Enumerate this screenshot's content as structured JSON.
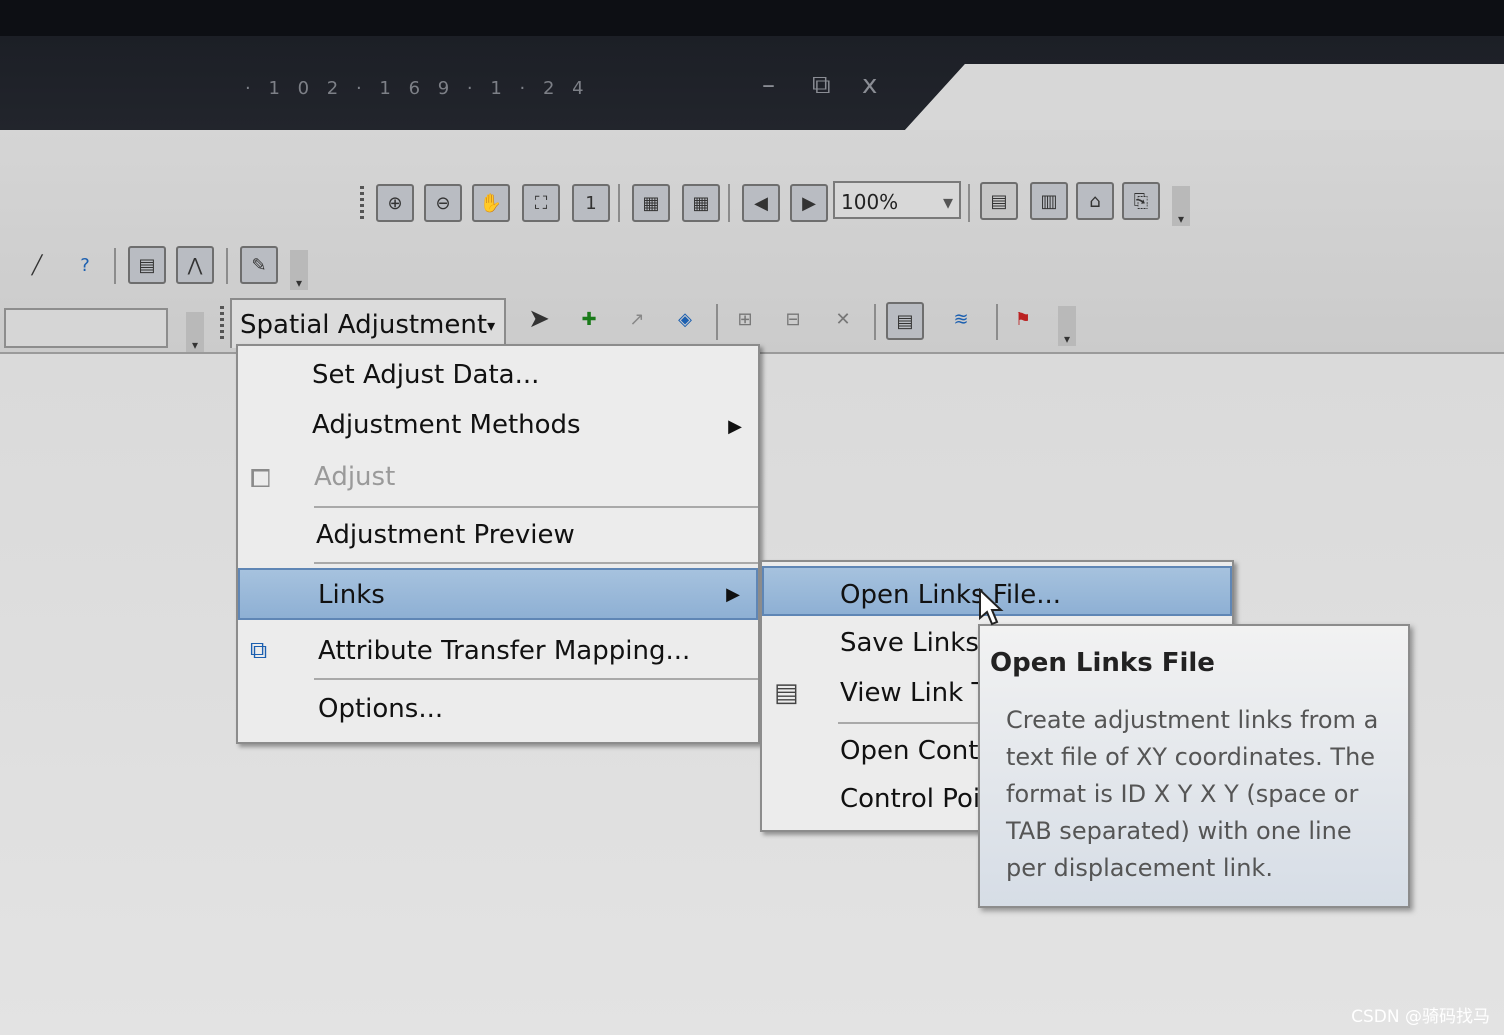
{
  "window": {
    "title": "· 1 0 2 · 1 6 9 · 1 · 2 4",
    "minimize_label": "–",
    "restore_label": "⧉",
    "close_label": "x"
  },
  "toolbar": {
    "zoom_value": "100%",
    "spatial_adjustment_label": "Spatial Adjustment",
    "spatial_adjustment_arrow": "▾"
  },
  "menu": {
    "items": [
      {
        "label": "Set Adjust Data...",
        "enabled": true
      },
      {
        "label": "Adjustment Methods",
        "enabled": true,
        "submenu": true
      },
      {
        "label": "Adjust",
        "enabled": false
      },
      {
        "label": "Adjustment Preview",
        "enabled": true
      },
      {
        "label": "Links",
        "enabled": true,
        "submenu": true,
        "highlighted": true
      },
      {
        "label": "Attribute Transfer Mapping...",
        "enabled": true
      },
      {
        "label": "Options...",
        "enabled": true
      }
    ],
    "submenu_arrow": "▶"
  },
  "links_submenu": {
    "items": [
      {
        "label": "Open Links File...",
        "highlighted": true
      },
      {
        "label": "Save Links"
      },
      {
        "label": "View Link T"
      },
      {
        "label": "Open Cont"
      },
      {
        "label": "Control Poi"
      }
    ]
  },
  "tooltip": {
    "title": "Open Links File",
    "body": "Create adjustment links from a text file of XY coordinates. The format is ID X Y X Y (space or TAB separated) with one line per displacement link."
  },
  "watermark": "CSDN @骑码找马",
  "colors": {
    "highlight": "#9bbad9",
    "menu_bg": "#ececec",
    "tooltip_bg": "#e4e8ee"
  },
  "icons": {
    "chevron": "▾"
  }
}
